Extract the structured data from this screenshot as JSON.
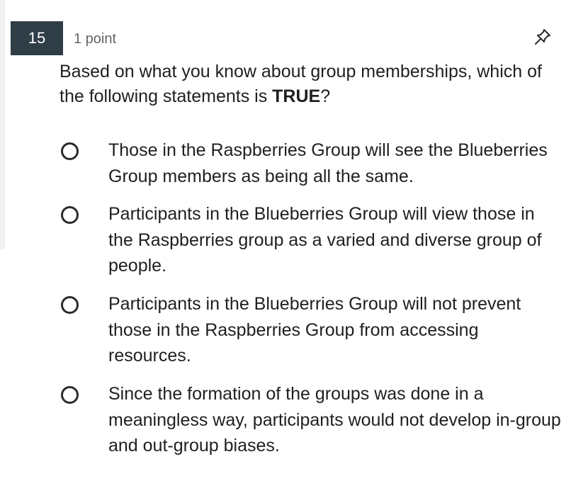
{
  "question": {
    "number": "15",
    "points": "1 point",
    "text_before": "Based on what you know about group memberships, which of the following statements is ",
    "text_emphasis": "TRUE",
    "text_after": "?"
  },
  "icons": {
    "pin": "pin-icon",
    "radio": "radio-unselected-icon"
  },
  "options": [
    {
      "label": "Those in the Raspberries Group will see the Blueberries Group members as being all the same.",
      "selected": false
    },
    {
      "label": "Participants in the Blueberries Group will view those in the Raspberries group as a varied and diverse group of people.",
      "selected": false
    },
    {
      "label": "Participants in the Blueberries Group will not prevent those in the Raspberries Group from accessing resources.",
      "selected": false
    },
    {
      "label": "Since the formation of the groups was done in a meaningless way, participants would not develop in-group and out-group biases.",
      "selected": false
    }
  ],
  "colors": {
    "number_badge_bg": "#2f3d47",
    "text": "#1f1f1f",
    "muted_text": "#636363"
  }
}
